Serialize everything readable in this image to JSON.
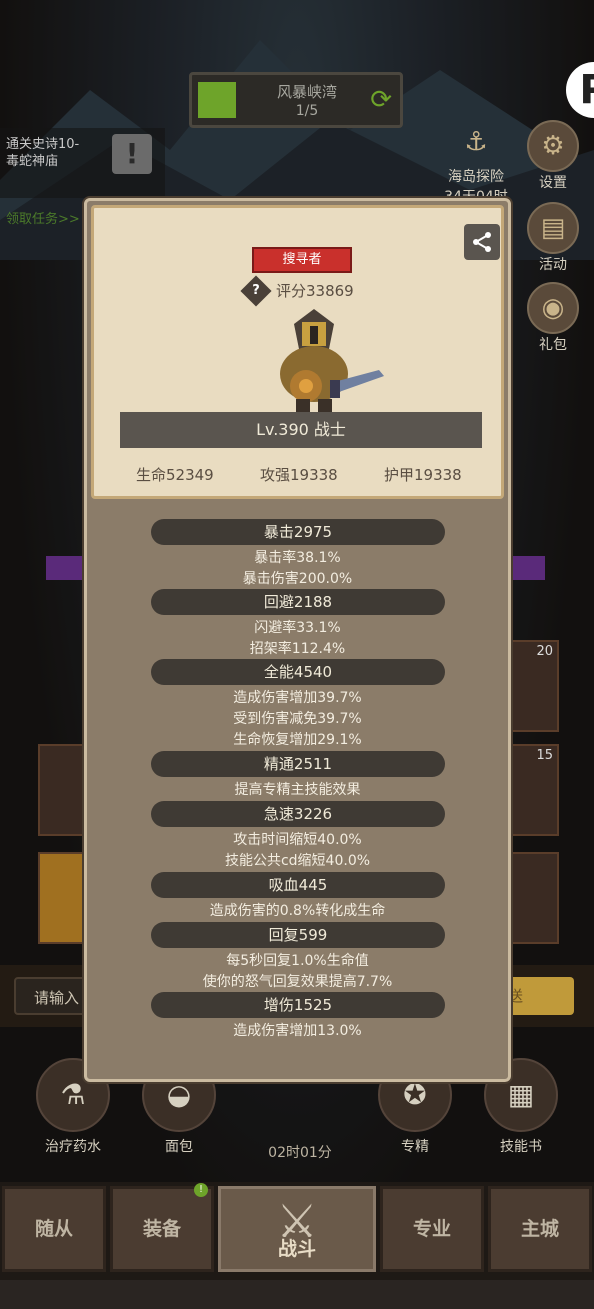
{
  "stage": {
    "name": "风暴峡湾",
    "progress": "1/5"
  },
  "quest": {
    "title_line1": "通关史诗10-",
    "title_line2": "毒蛇神庙",
    "link": "领取任务>>"
  },
  "side": {
    "island_label1": "海岛探险",
    "island_label2": "34天04时",
    "settings_label": "设置",
    "activity_label": "活动",
    "gift_label": "礼包"
  },
  "tiles": {
    "count1": "20",
    "count2": "15"
  },
  "chat": {
    "placeholder": "请输入",
    "send_label": "送"
  },
  "items": [
    {
      "label": "治疗药水",
      "icon": "potion-icon"
    },
    {
      "label": "面包",
      "icon": "bread-icon"
    },
    {
      "label": "专精",
      "icon": "mastery-icon"
    },
    {
      "label": "技能书",
      "icon": "book-icon"
    }
  ],
  "timer": "02时01分",
  "nav": {
    "followers": "随从",
    "equipment": "装备",
    "battle": "战斗",
    "profession": "专业",
    "city": "主城",
    "equipment_badge": "!"
  },
  "card": {
    "tag": "搜寻者",
    "score": "评分33869",
    "level": "Lv.390 战士",
    "hp": "生命52349",
    "atk": "攻强19338",
    "armor": "护甲19338"
  },
  "stats": {
    "crit": "暴击2975",
    "crit_rate": "暴击率38.1%",
    "crit_dmg": "暴击伤害200.0%",
    "dodge": "回避2188",
    "dodge_rate": "闪避率33.1%",
    "parry_rate": "招架率112.4%",
    "versatility": "全能4540",
    "dmg_up": "造成伤害增加39.7%",
    "dmg_taken_down": "受到伤害减免39.7%",
    "regen_up": "生命恢复增加29.1%",
    "mastery": "精通2511",
    "mastery_desc": "提高专精主技能效果",
    "haste": "急速3226",
    "attack_time": "攻击时间缩短40.0%",
    "gcd": "技能公共cd缩短40.0%",
    "lifesteal": "吸血445",
    "lifesteal_desc": "造成伤害的0.8%转化成生命",
    "recovery": "回复599",
    "recovery_desc1": "每5秒回复1.0%生命值",
    "recovery_desc2": "使你的怒气回复效果提高7.7%",
    "dmg_bonus": "增伤1525",
    "dmg_bonus_desc": "造成伤害增加13.0%"
  }
}
